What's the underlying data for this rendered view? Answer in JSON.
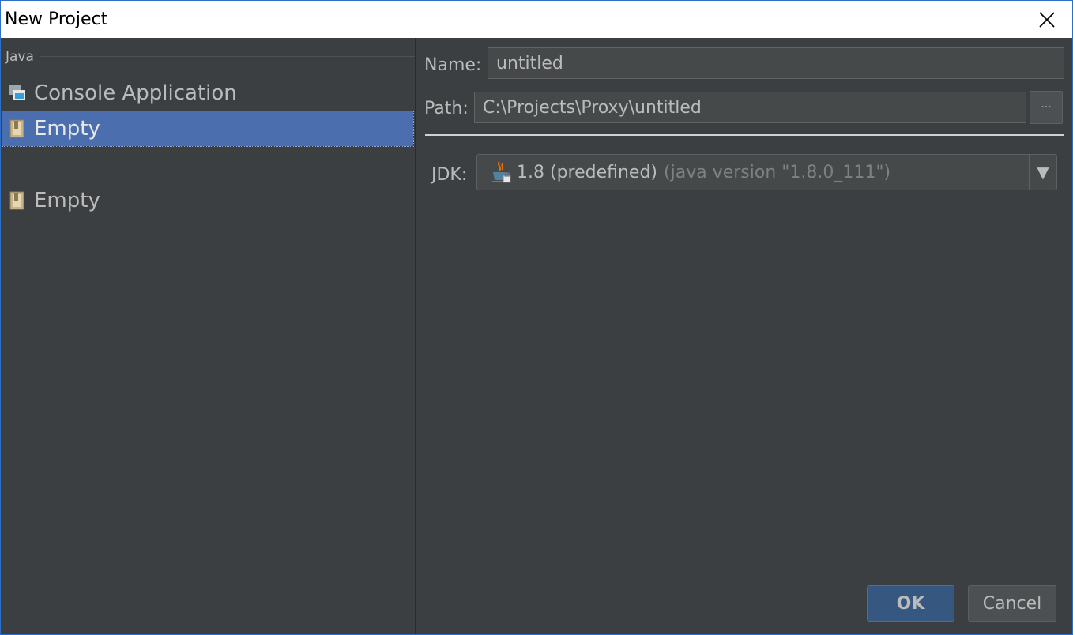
{
  "window": {
    "title": "New Project"
  },
  "left": {
    "group_label": "Java",
    "items": [
      {
        "label": "Console Application",
        "icon": "console-app-icon",
        "selected": false
      },
      {
        "label": "Empty",
        "icon": "empty-file-icon",
        "selected": true
      },
      {
        "label": "Empty",
        "icon": "empty-file-icon",
        "selected": false
      }
    ]
  },
  "form": {
    "name_label": "Name:",
    "name_value": "untitled",
    "path_label": "Path:",
    "path_value": "C:\\Projects\\Proxy\\untitled",
    "browse_label": "···",
    "jdk_label": "JDK:",
    "jdk_value": "1.8 (predefined)",
    "jdk_detail": "(java version \"1.8.0_111\")",
    "jdk_icon": "java-cup-icon",
    "dropdown_arrow": "▼"
  },
  "buttons": {
    "ok": "OK",
    "cancel": "Cancel"
  },
  "colors": {
    "background": "#3c3f41",
    "selection": "#4b6eaf",
    "ok_button": "#365880",
    "window_border": "#2d6fc4"
  }
}
